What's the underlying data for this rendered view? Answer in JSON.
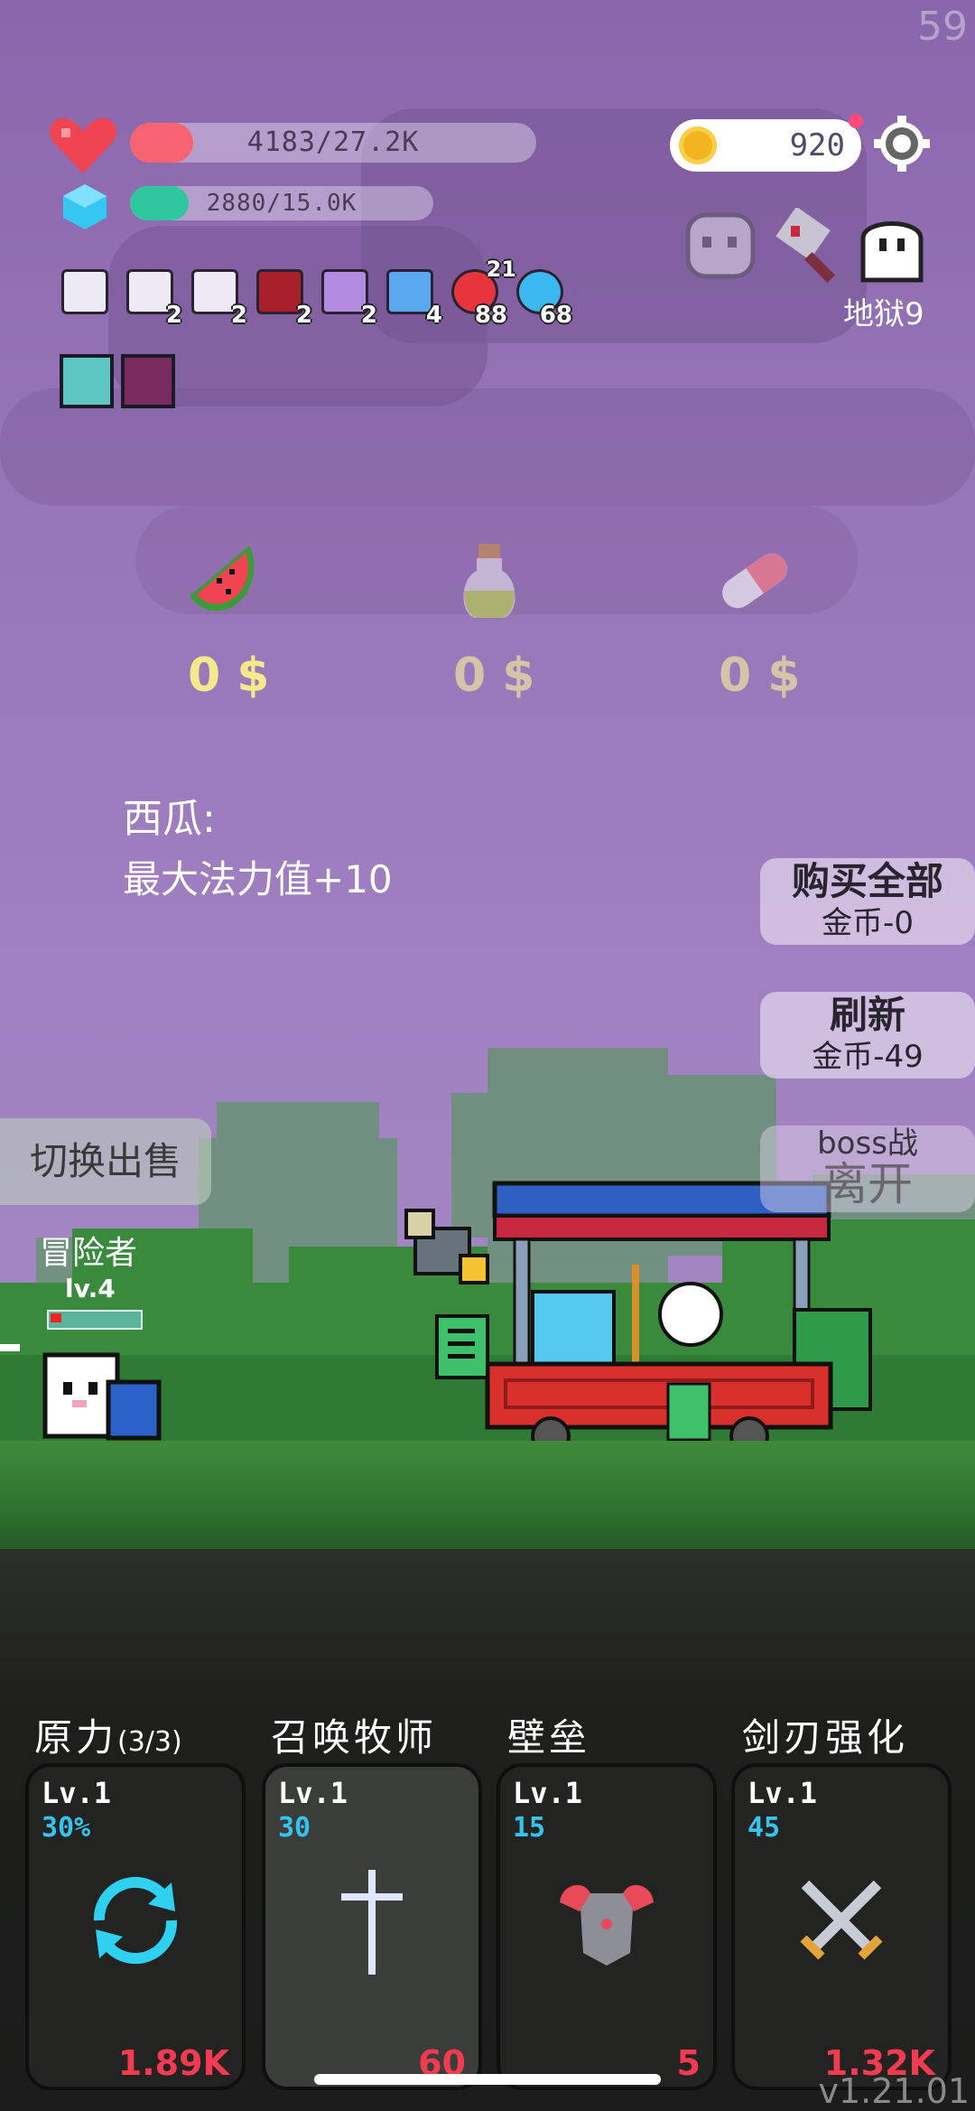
{
  "fps": "59",
  "hp": {
    "text": "4183/27.2K",
    "fill": 0.153,
    "color": "#f56470"
  },
  "mana": {
    "text": "2880/15.0K",
    "fill": 0.192,
    "color": "#2fc7a0"
  },
  "coins": "920",
  "hell_label": "地狱9",
  "buffs": [
    {
      "icon": "scroll-icon",
      "count": ""
    },
    {
      "icon": "scroll-icon",
      "count": "2"
    },
    {
      "icon": "scroll-icon",
      "count": "2"
    },
    {
      "icon": "demon-helmet-icon",
      "count": "2"
    },
    {
      "icon": "magic-wand-icon",
      "count": "2"
    },
    {
      "icon": "star-card-icon",
      "count": "4"
    },
    {
      "icon": "apple-icon",
      "count": "88",
      "extra": "21"
    },
    {
      "icon": "chat-bubble-icon",
      "count": "68"
    }
  ],
  "shop": {
    "items": [
      {
        "icon": "watermelon-icon",
        "price": "0 $",
        "color": "#f5e98c"
      },
      {
        "icon": "potion-icon",
        "price": "0 $",
        "color": "#d6c4a8"
      },
      {
        "icon": "pill-icon",
        "price": "0 $",
        "color": "#d6c4a8"
      }
    ],
    "selected_name": "西瓜:",
    "selected_desc": "最大法力值+10"
  },
  "buttons": {
    "buy_all": "购买全部",
    "buy_all_cost": "金币-0",
    "refresh": "刷新",
    "refresh_cost": "金币-49",
    "boss": "boss战",
    "leave": "离开",
    "switch_sell": "切换出售"
  },
  "hero": {
    "name": "冒险者",
    "level": "lv.4"
  },
  "skills": [
    {
      "name": "原力",
      "suffix": "(3/3)",
      "level": "Lv.1",
      "value": "30%",
      "cost": "1.89K",
      "icon": "refresh-cycle-icon"
    },
    {
      "name": "召唤牧师",
      "suffix": "",
      "level": "Lv.1",
      "value": "30",
      "cost": "60",
      "icon": "cross-icon"
    },
    {
      "name": "壁垒",
      "suffix": "",
      "level": "Lv.1",
      "value": "15",
      "cost": "5",
      "icon": "armor-icon"
    },
    {
      "name": "剑刃强化",
      "suffix": "",
      "level": "Lv.1",
      "value": "45",
      "cost": "1.32K",
      "icon": "crossed-swords-icon"
    }
  ],
  "version": "v1.21.01"
}
